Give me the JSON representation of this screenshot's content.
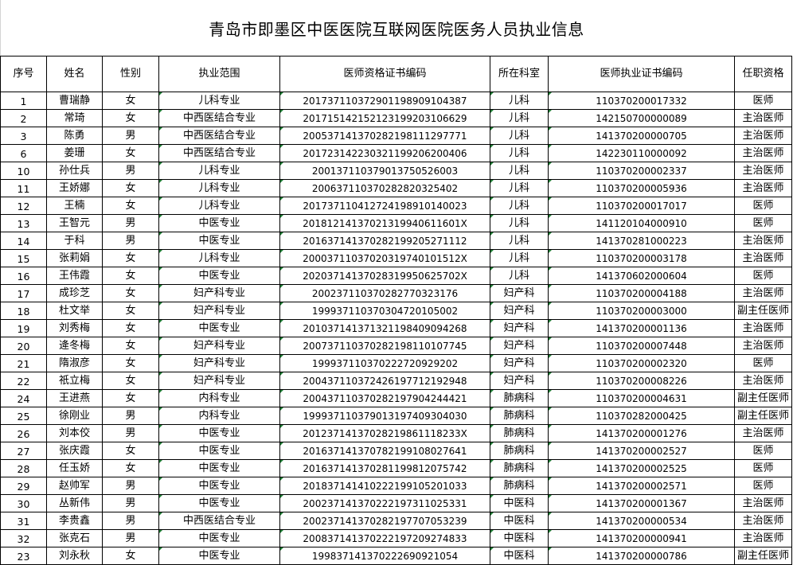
{
  "title": "青岛市即墨区中医医院互联网医院医务人员执业信息",
  "headers": {
    "seq": "序号",
    "name": "姓名",
    "gender": "性别",
    "scope": "执业范围",
    "qualification_no": "医师资格证书编码",
    "department": "所在科室",
    "license_no": "医师执业证书编码",
    "title": "任职资格"
  },
  "rows": [
    {
      "seq": "1",
      "name": "曹瑞静",
      "gender": "女",
      "scope": "儿科专业",
      "qualification_no": "201737110372901198909104387",
      "department": "儿科",
      "license_no": "110370200017332",
      "title": "医师"
    },
    {
      "seq": "2",
      "name": "常琦",
      "gender": "女",
      "scope": "中西医结合专业",
      "qualification_no": "201715142152123199203106629",
      "department": "儿科",
      "license_no": "142150700000089",
      "title": "主治医师"
    },
    {
      "seq": "3",
      "name": "陈勇",
      "gender": "男",
      "scope": "中西医结合专业",
      "qualification_no": "200537141370282198111297771",
      "department": "儿科",
      "license_no": "141370200000705",
      "title": "主治医师"
    },
    {
      "seq": "6",
      "name": "姜珊",
      "gender": "女",
      "scope": "中西医结合专业",
      "qualification_no": "201723142230321199206200406",
      "department": "儿科",
      "license_no": "142230110000092",
      "title": "主治医师"
    },
    {
      "seq": "10",
      "name": "孙仕兵",
      "gender": "男",
      "scope": "儿科专业",
      "qualification_no": "200137110379013750526003",
      "department": "儿科",
      "license_no": "110370200002337",
      "title": "主治医师"
    },
    {
      "seq": "11",
      "name": "王娇娜",
      "gender": "女",
      "scope": "儿科专业",
      "qualification_no": "200637110370282820325402",
      "department": "儿科",
      "license_no": "110370200005936",
      "title": "主治医师"
    },
    {
      "seq": "12",
      "name": "王楠",
      "gender": "女",
      "scope": "儿科专业",
      "qualification_no": "201737110412724198910140023",
      "department": "儿科",
      "license_no": "110370200017017",
      "title": "医师"
    },
    {
      "seq": "13",
      "name": "王智元",
      "gender": "男",
      "scope": "中医专业",
      "qualification_no": "20181214137021319940611601X",
      "department": "儿科",
      "license_no": "141120104000910",
      "title": "医师"
    },
    {
      "seq": "14",
      "name": "于科",
      "gender": "男",
      "scope": "中医专业",
      "qualification_no": "201637141370282199205271112",
      "department": "儿科",
      "license_no": "141370281000223",
      "title": "主治医师"
    },
    {
      "seq": "15",
      "name": "张莉娟",
      "gender": "女",
      "scope": "儿科专业",
      "qualification_no": "20003711037020319740101512X",
      "department": "儿科",
      "license_no": "110370200003178",
      "title": "主治医师"
    },
    {
      "seq": "16",
      "name": "王伟霞",
      "gender": "女",
      "scope": "中医专业",
      "qualification_no": "20203714137028319950625702X",
      "department": "儿科",
      "license_no": "141370602000604",
      "title": "医师"
    },
    {
      "seq": "17",
      "name": "成珍芝",
      "gender": "女",
      "scope": "妇产科专业",
      "qualification_no": "200237110370282770323176",
      "department": "妇产科",
      "license_no": "110370200004188",
      "title": "主治医师"
    },
    {
      "seq": "18",
      "name": "杜文举",
      "gender": "女",
      "scope": "妇产科专业",
      "qualification_no": "199937110370304720105002",
      "department": "妇产科",
      "license_no": "110370200003000",
      "title": "副主任医师"
    },
    {
      "seq": "19",
      "name": "刘秀梅",
      "gender": "女",
      "scope": "中医专业",
      "qualification_no": "201037141371321198409094268",
      "department": "妇产科",
      "license_no": "141370200001136",
      "title": "主治医师"
    },
    {
      "seq": "20",
      "name": "逄冬梅",
      "gender": "女",
      "scope": "妇产科专业",
      "qualification_no": "200737110370282198110107745",
      "department": "妇产科",
      "license_no": "110370200007448",
      "title": "主治医师"
    },
    {
      "seq": "21",
      "name": "隋淑彦",
      "gender": "女",
      "scope": "妇产科专业",
      "qualification_no": "199937110370222720929202",
      "department": "妇产科",
      "license_no": "110370200002320",
      "title": "医师"
    },
    {
      "seq": "22",
      "name": "祇立梅",
      "gender": "女",
      "scope": "妇产科专业",
      "qualification_no": "200437110372426197712192948",
      "department": "妇产科",
      "license_no": "110370200008226",
      "title": "主治医师"
    },
    {
      "seq": "24",
      "name": "王进燕",
      "gender": "女",
      "scope": "内科专业",
      "qualification_no": "200437110370282197904244421",
      "department": "肺病科",
      "license_no": "110370200004631",
      "title": "副主任医师"
    },
    {
      "seq": "25",
      "name": "徐刚业",
      "gender": "男",
      "scope": "内科专业",
      "qualification_no": "199937110379013197409304030",
      "department": "肺病科",
      "license_no": "110370282000425",
      "title": "副主任医师"
    },
    {
      "seq": "26",
      "name": "刘本佼",
      "gender": "男",
      "scope": "中医专业",
      "qualification_no": "20123714137028219861118233X",
      "department": "肺病科",
      "license_no": "141370200001276",
      "title": "主治医师"
    },
    {
      "seq": "27",
      "name": "张庆霞",
      "gender": "女",
      "scope": "中医专业",
      "qualification_no": "201637141370782199108027641",
      "department": "肺病科",
      "license_no": "141370200002527",
      "title": "医师"
    },
    {
      "seq": "28",
      "name": "任玉娇",
      "gender": "女",
      "scope": "中医专业",
      "qualification_no": "201637141370281199812075742",
      "department": "肺病科",
      "license_no": "141370200002525",
      "title": "医师"
    },
    {
      "seq": "29",
      "name": "赵帅军",
      "gender": "男",
      "scope": "中医专业",
      "qualification_no": "201837141410222199105201033",
      "department": "肺病科",
      "license_no": "141370200002571",
      "title": "医师"
    },
    {
      "seq": "30",
      "name": "丛新伟",
      "gender": "男",
      "scope": "中医专业",
      "qualification_no": "200237141370222197311025331",
      "department": "中医科",
      "license_no": "141370200001367",
      "title": "主治医师"
    },
    {
      "seq": "31",
      "name": "李贵鑫",
      "gender": "男",
      "scope": "中西医结合专业",
      "qualification_no": "200237141370282197707053239",
      "department": "中医科",
      "license_no": "141370200000534",
      "title": "主治医师"
    },
    {
      "seq": "32",
      "name": "张克石",
      "gender": "男",
      "scope": "中医专业",
      "qualification_no": "200837141370222197209274833",
      "department": "中医科",
      "license_no": "141370200000941",
      "title": "主治医师"
    },
    {
      "seq": "23",
      "name": "刘永秋",
      "gender": "女",
      "scope": "中医专业",
      "qualification_no": "199837141370222690921054",
      "department": "中医科",
      "license_no": "141370200000786",
      "title": "副主任医师"
    }
  ]
}
